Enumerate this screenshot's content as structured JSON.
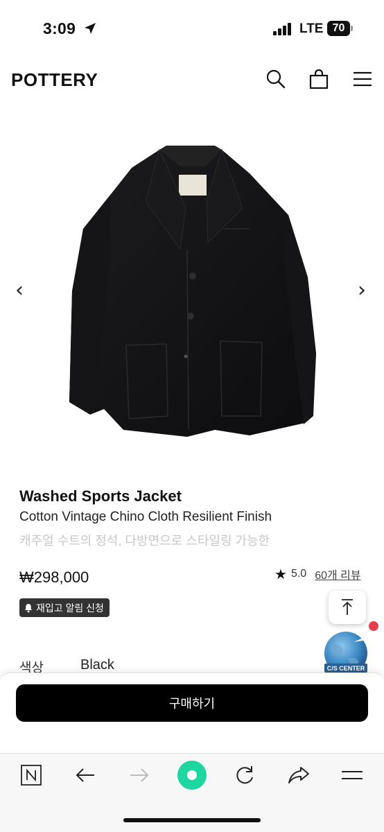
{
  "status_bar": {
    "time": "3:09",
    "network": "LTE",
    "battery": "70",
    "icons": [
      "location-arrow-icon",
      "signal-icon",
      "battery-icon"
    ]
  },
  "header": {
    "logo": "POTTERY",
    "icons": [
      "search-icon",
      "shopping-bag-icon",
      "menu-icon"
    ]
  },
  "carousel": {
    "prev": "‹",
    "next": "›"
  },
  "product": {
    "name": "Washed Sports Jacket",
    "subtitle": "Cotton Vintage Chino Cloth Resilient Finish",
    "description": "캐주얼 수트의 정석, 다방면으로 스타일링 가능한",
    "price": "₩298,000",
    "rating": "5.0",
    "reviews": "60개 리뷰",
    "restock_label": "재입고 알림 신청"
  },
  "options": {
    "color_label": "색상",
    "color_value": "Black"
  },
  "cs_badge": "C/S CENTER",
  "buy_button": "구매하기",
  "toolbar": {
    "icons": [
      "naver-n-icon",
      "back-arrow-icon",
      "forward-arrow-icon",
      "green-dot-icon",
      "reload-icon",
      "share-icon",
      "menu-icon"
    ]
  },
  "colors": {
    "accent_green": "#1ed6a0",
    "notification_red": "#e2404d",
    "buy_button_bg": "#000000"
  }
}
